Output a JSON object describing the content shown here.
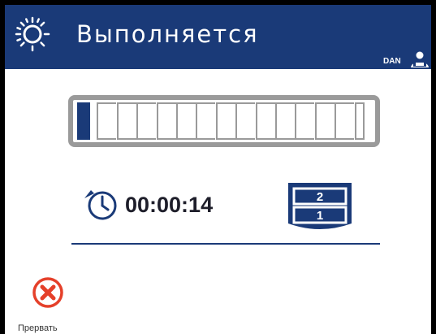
{
  "header": {
    "title": "Выполняется",
    "status_icon": "spinner-sun-icon",
    "user_name": "DAN",
    "user_icon": "user-icon",
    "background_color": "#1a3a78"
  },
  "progress": {
    "segments_total": 15,
    "segments_filled": 1,
    "fill_color": "#1a3a78"
  },
  "timer": {
    "icon": "stopwatch-icon",
    "elapsed": "00:00:14"
  },
  "trays": {
    "icon": "tray-stack-icon",
    "labels": [
      "2",
      "1"
    ]
  },
  "actions": {
    "abort_label": "Прервать",
    "abort_icon": "close-circle-icon",
    "abort_color": "#e5402a"
  }
}
